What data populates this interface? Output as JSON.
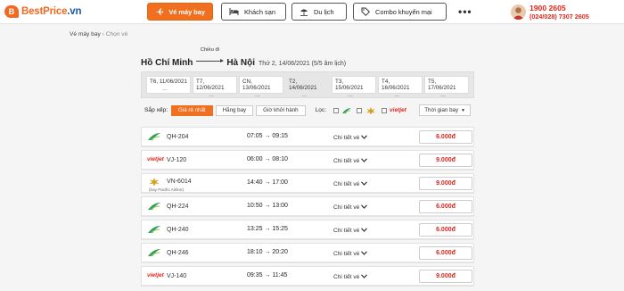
{
  "brand": {
    "name": "BestPrice",
    "tld": ".vn",
    "mark": "B"
  },
  "nav": [
    {
      "label": "Vé máy bay",
      "icon": "plane-icon",
      "active": true
    },
    {
      "label": "Khách sạn",
      "icon": "bed-icon",
      "active": false
    },
    {
      "label": "Du lịch",
      "icon": "umbrella-icon",
      "active": false
    },
    {
      "label": "Combo khuyến mại",
      "icon": "tag-icon",
      "active": false
    }
  ],
  "more_label": "•••",
  "hotline": {
    "phone1": "1900 2605",
    "phone2": "(024/028) 7307 2605"
  },
  "breadcrumb": {
    "home": "Vé máy bay",
    "sep": " › ",
    "current": "Chọn vé"
  },
  "route": {
    "from": "Hồ Chí Minh",
    "direction": "Chiều đi",
    "to": "Hà Nội",
    "date": "Thứ 2, 14/06/2021 (5/5 âm lịch)"
  },
  "days": [
    {
      "label": "T6, 11/06/2021",
      "price": "---"
    },
    {
      "label": "T7, 12/06/2021",
      "price": "---"
    },
    {
      "label": "CN, 13/06/2021",
      "price": "---"
    },
    {
      "label": "T2, 14/06/2021",
      "price": "---",
      "active": true
    },
    {
      "label": "T3, 15/06/2021",
      "price": "---"
    },
    {
      "label": "T4, 16/06/2021",
      "price": "---"
    },
    {
      "label": "T5, 17/06/2021",
      "price": "---"
    }
  ],
  "sort": {
    "label": "Sắp xếp:",
    "options": [
      "Giá rẻ nhất",
      "Hãng bay",
      "Giờ khởi hành"
    ],
    "filter_label": "Lọc:",
    "time_select": "Thời gian bay"
  },
  "airline_colors": {
    "bamboo": "#2e9e5b",
    "vietjet": "#e0281d",
    "vietnam": "#d8a020",
    "accent": "#f07020"
  },
  "flights": [
    {
      "airline": "bamboo",
      "code": "QH-204",
      "time": "07:05 → 09:15",
      "detail": "Chi tiết vé",
      "price": "6.000đ"
    },
    {
      "airline": "vietjet",
      "code": "VJ-120",
      "time": "06:00 → 08:10",
      "detail": "Chi tiết vé",
      "price": "9.000đ"
    },
    {
      "airline": "vietnam",
      "code": "VN-6014",
      "sub": "(bay Pacific Airline)",
      "time": "14:40 → 17:00",
      "detail": "Chi tiết vé",
      "price": "9.000đ"
    },
    {
      "airline": "bamboo",
      "code": "QH-224",
      "time": "10:50 → 13:00",
      "detail": "Chi tiết vé",
      "price": "6.000đ"
    },
    {
      "airline": "bamboo",
      "code": "QH-240",
      "time": "13:25 → 15:25",
      "detail": "Chi tiết vé",
      "price": "6.000đ"
    },
    {
      "airline": "bamboo",
      "code": "QH-246",
      "time": "18:10 → 20:20",
      "detail": "Chi tiết vé",
      "price": "6.000đ"
    },
    {
      "airline": "vietjet",
      "code": "VJ-140",
      "time": "09:35 → 11:45",
      "detail": "Chi tiết vé",
      "price": "9.000đ"
    }
  ],
  "vietjet_wordmark": "vietjet"
}
